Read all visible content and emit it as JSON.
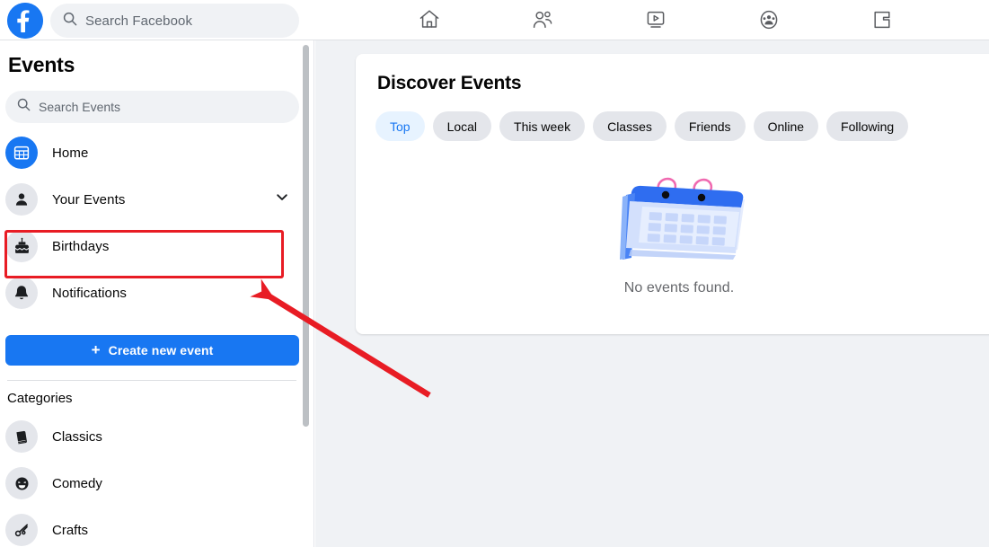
{
  "header": {
    "logo_icon": "facebook-logo-icon",
    "search": {
      "icon": "search-icon",
      "placeholder": "Search Facebook",
      "value": ""
    },
    "nav_items": [
      {
        "name": "home",
        "icon": "home-icon",
        "label": "Home"
      },
      {
        "name": "friends",
        "icon": "friends-icon",
        "label": "Friends"
      },
      {
        "name": "watch",
        "icon": "watch-video-icon",
        "label": "Watch"
      },
      {
        "name": "groups",
        "icon": "groups-icon",
        "label": "Groups"
      },
      {
        "name": "gaming",
        "icon": "gaming-icon",
        "label": "Gaming"
      }
    ]
  },
  "sidebar": {
    "title": "Events",
    "search": {
      "icon": "search-icon",
      "placeholder": "Search Events",
      "value": ""
    },
    "nav_items": [
      {
        "label": "Home",
        "icon": "calendar-icon",
        "accent": true,
        "has_chevron": false,
        "highlighted": false
      },
      {
        "label": "Your Events",
        "icon": "person-icon",
        "accent": false,
        "has_chevron": true,
        "highlighted": false
      },
      {
        "label": "Birthdays",
        "icon": "birthday-cake-icon",
        "accent": false,
        "has_chevron": false,
        "highlighted": true
      },
      {
        "label": "Notifications",
        "icon": "bell-icon",
        "accent": false,
        "has_chevron": false,
        "highlighted": false
      }
    ],
    "create_button": {
      "label": "Create new event",
      "plus": "+"
    },
    "categories_heading": "Categories",
    "categories": [
      {
        "label": "Classics",
        "icon": "book-icon",
        "glyph": "📕"
      },
      {
        "label": "Comedy",
        "icon": "laughing-face-icon",
        "glyph": "😆"
      },
      {
        "label": "Crafts",
        "icon": "scissors-icon",
        "glyph": "✂"
      }
    ]
  },
  "main": {
    "card_title": "Discover Events",
    "filters": [
      {
        "label": "Top",
        "active": true
      },
      {
        "label": "Local",
        "active": false
      },
      {
        "label": "This week",
        "active": false
      },
      {
        "label": "Classes",
        "active": false
      },
      {
        "label": "Friends",
        "active": false
      },
      {
        "label": "Online",
        "active": false
      },
      {
        "label": "Following",
        "active": false
      }
    ],
    "empty_state": {
      "illustration": "calendar-illustration",
      "message": "No events found."
    }
  },
  "annotations": {
    "highlight_box": {
      "target": "Birthdays",
      "color": "#e81c24"
    },
    "arrow": {
      "color": "#e81c24",
      "points_to": "Birthdays"
    }
  },
  "colors": {
    "brand_blue": "#1877f2",
    "pill_active_bg": "#e7f3ff",
    "pill_bg": "#e4e6eb",
    "page_bg": "#f0f2f5",
    "annotation_red": "#e81c24",
    "text_primary": "#050505",
    "text_secondary": "#65676b"
  }
}
